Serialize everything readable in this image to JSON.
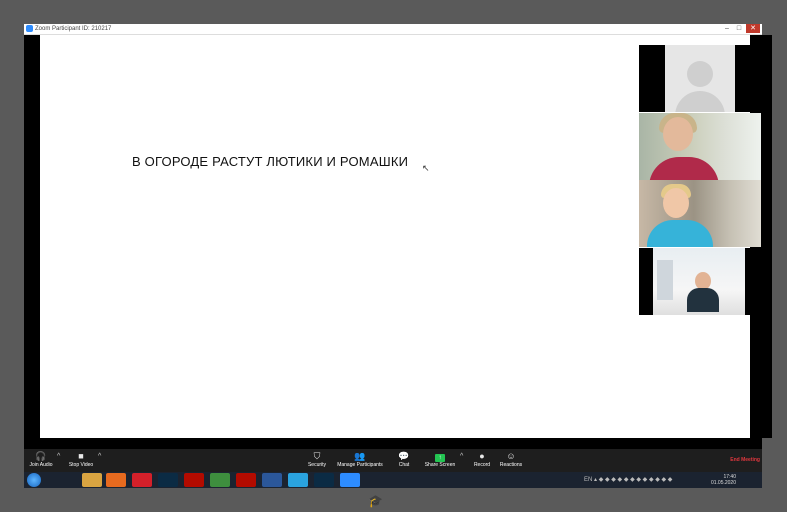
{
  "window": {
    "title": "Zoom Participant ID: 210217",
    "controls": [
      "–",
      "□",
      "✕"
    ]
  },
  "slide": {
    "text": "В ОГОРОДЕ РАСТУТ ЛЮТИКИ И РОМАШКИ"
  },
  "toolbar": {
    "join_audio": "Join Audio",
    "stop_video": "Stop Video",
    "security": "Security",
    "manage_participants": "Manage Participants",
    "chat": "Chat",
    "share_screen": "Share Screen",
    "record": "Record",
    "reactions": "Reactions",
    "end_meeting": "End Meeting"
  },
  "taskbar": {
    "language": "EN",
    "time": "17:40",
    "date": "01.05.2020"
  },
  "colors": {
    "end_meeting": "#e0373e",
    "share_green": "#23c552",
    "zoom_blue": "#2d8cff"
  }
}
